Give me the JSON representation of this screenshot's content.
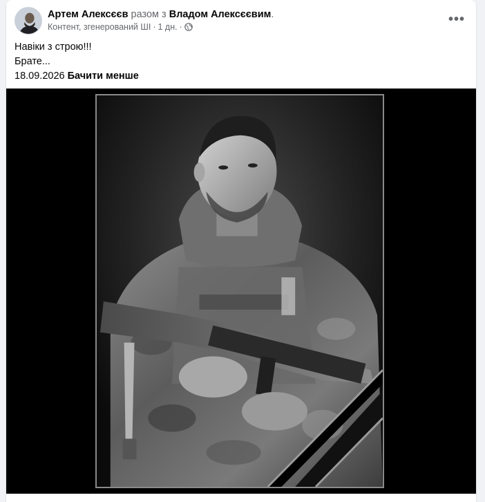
{
  "post": {
    "author_name": "Артем Алексєєв",
    "with_text": "разом з",
    "tagged_name": "Владом Алексєєвим",
    "tagged_suffix": ".",
    "ai_label": "Контент, згенерований ШІ",
    "separator": "·",
    "time": "1 дн.",
    "separator2": "·",
    "privacy_icon": "globe-icon",
    "more_icon": "more-horizontal-icon",
    "more_label": "•••",
    "text_lines": [
      "Навіки з строю!!!",
      "Брате..."
    ],
    "date_text": "18.09.2026",
    "see_less_label": "Бачити менше"
  },
  "media": {
    "type": "memorial-portrait-photo",
    "background_color": "#000000",
    "frame_color": "#8a8a8a"
  },
  "colors": {
    "card_bg": "#ffffff",
    "page_bg": "#f0f2f5",
    "primary_text": "#050505",
    "secondary_text": "#65676b"
  }
}
